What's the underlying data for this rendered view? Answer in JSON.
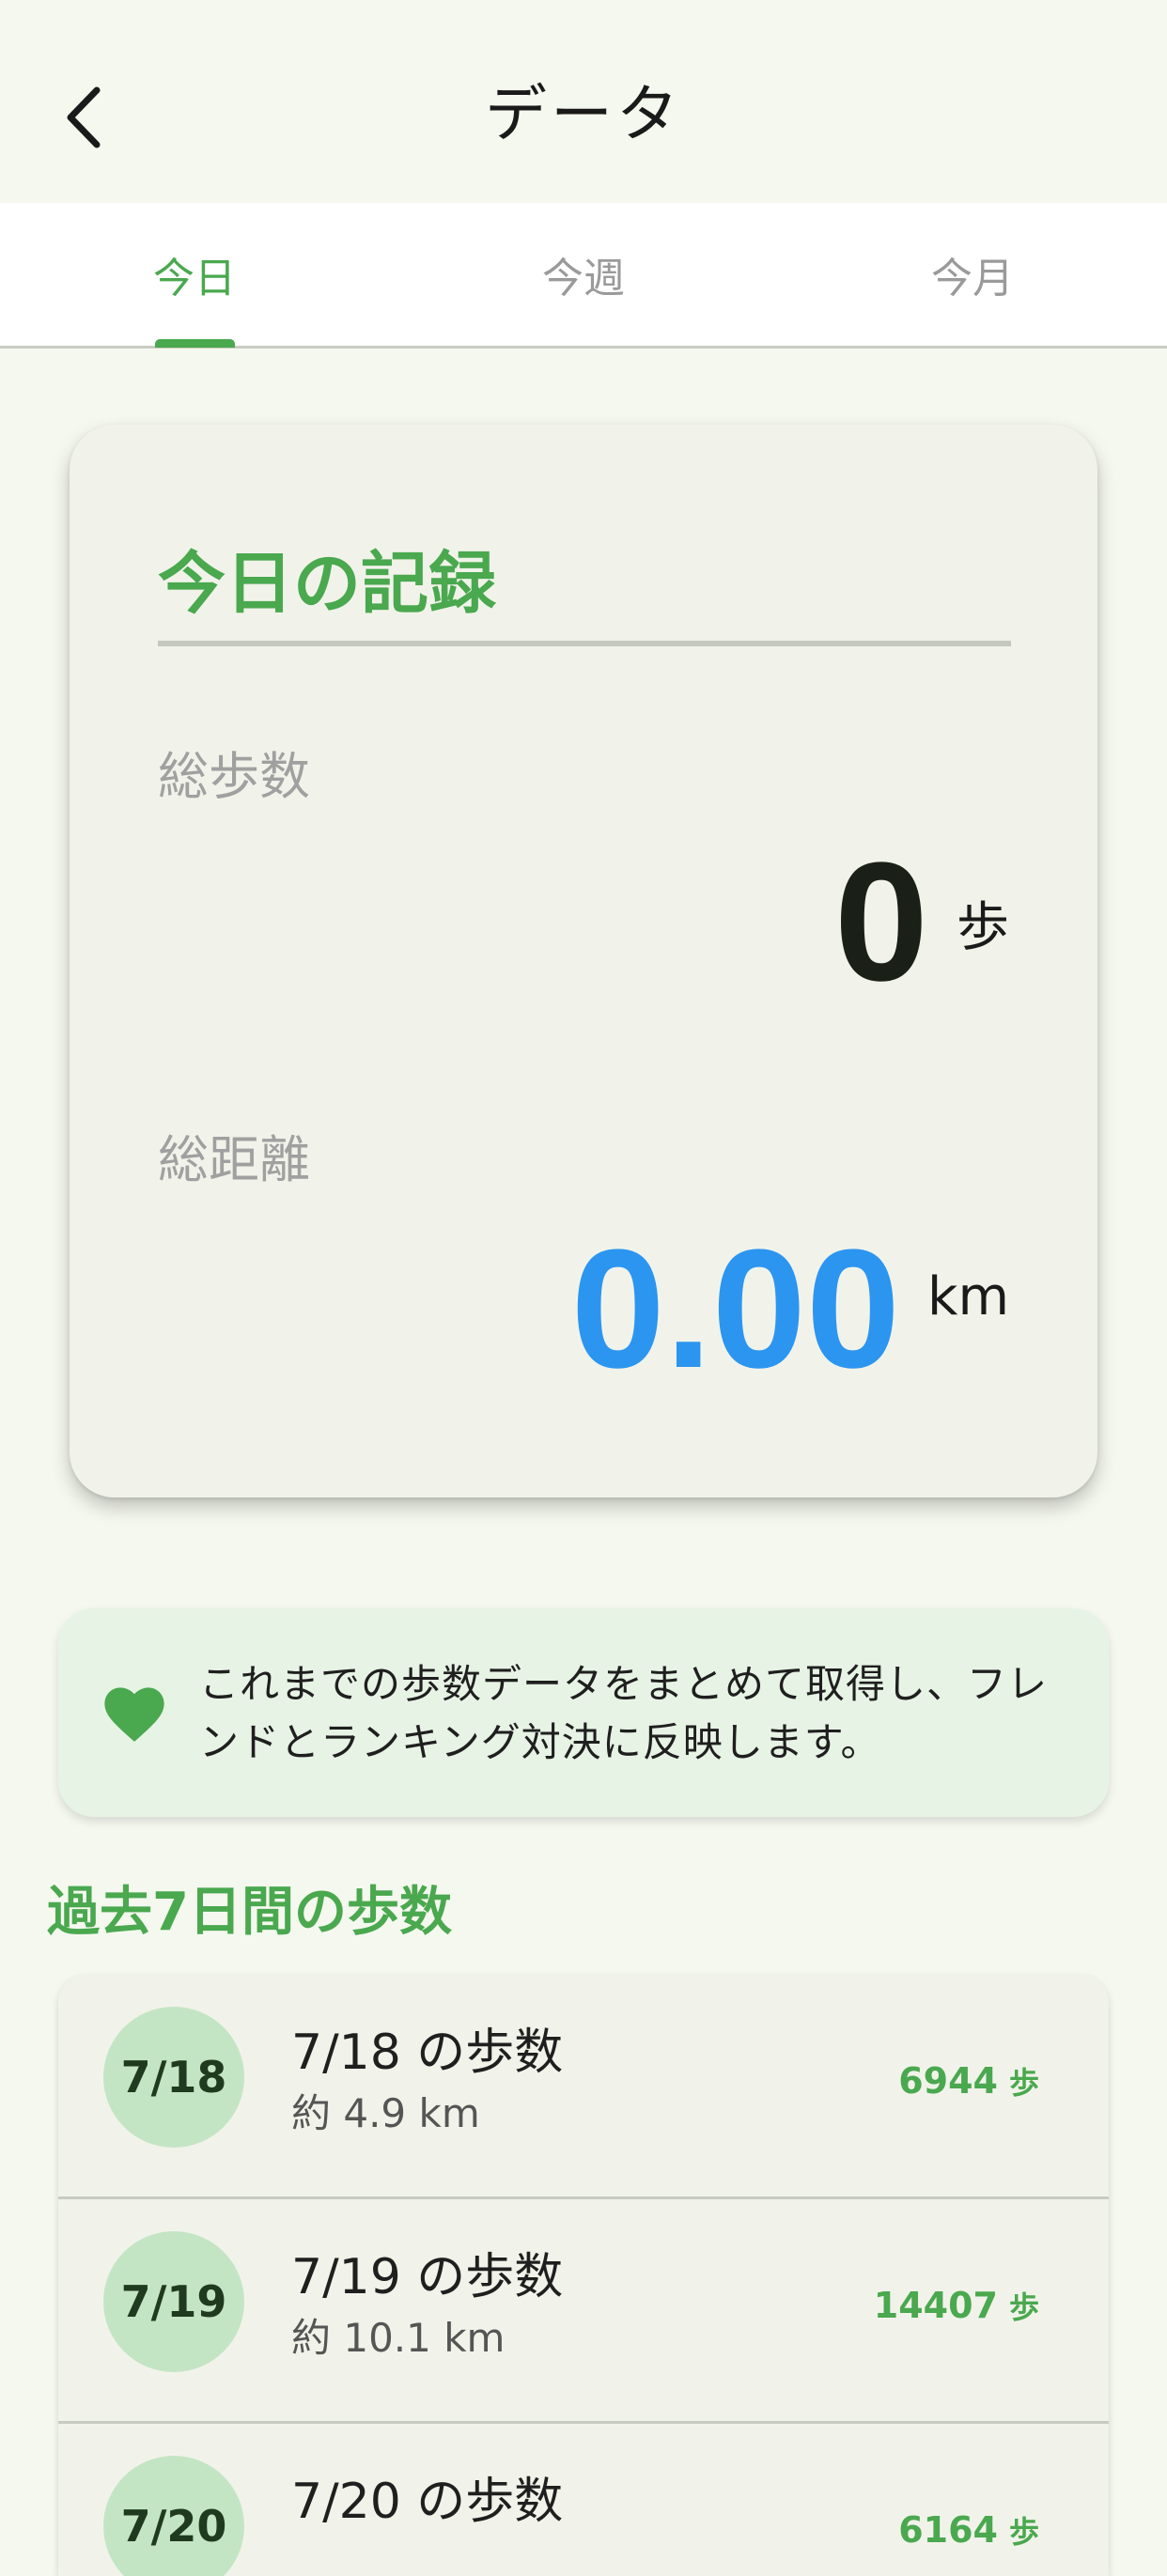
{
  "header": {
    "title": "データ"
  },
  "tabs": [
    {
      "label": "今日",
      "active": true
    },
    {
      "label": "今週",
      "active": false
    },
    {
      "label": "今月",
      "active": false
    }
  ],
  "summary": {
    "title": "今日の記録",
    "steps_label": "総歩数",
    "steps_value": "0",
    "steps_unit": "歩",
    "distance_label": "総距離",
    "distance_value": "0.00",
    "distance_unit": "km"
  },
  "notice": {
    "line1": "これまでの歩数データをまとめて取得し、フレ",
    "line2": "ンドとランキング対決に反映します。"
  },
  "history": {
    "title": "過去7日間の歩数",
    "items": [
      {
        "date": "7/18",
        "title": "7/18 の歩数",
        "distance": "約 4.9 km",
        "steps": "6944",
        "unit": "歩"
      },
      {
        "date": "7/19",
        "title": "7/19 の歩数",
        "distance": "約 10.1 km",
        "steps": "14407",
        "unit": "歩"
      },
      {
        "date": "7/20",
        "title": "7/20 の歩数",
        "distance": "",
        "steps": "6164",
        "unit": "歩"
      }
    ]
  },
  "colors": {
    "accent": "#4aa84f",
    "distance": "#2c95f0",
    "background": "#f5f8ef"
  }
}
